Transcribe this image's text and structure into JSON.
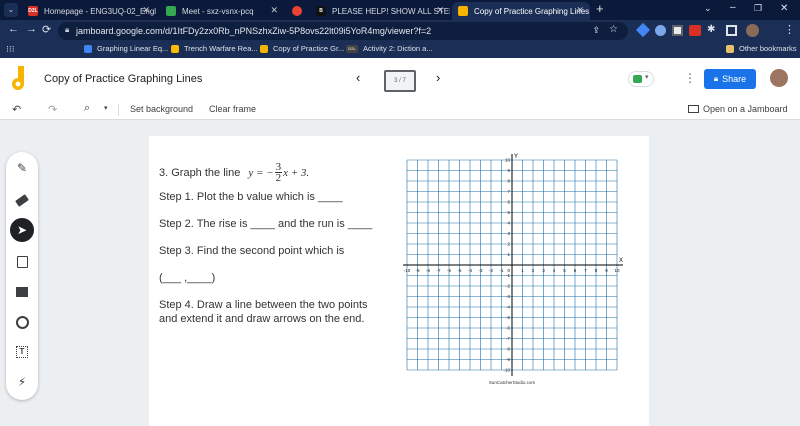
{
  "browser": {
    "tabs": [
      {
        "title": "Homepage - ENG3UQ-02_English",
        "favicon_text": "D2L",
        "favicon_color": "#d93025",
        "active": false
      },
      {
        "title": "Meet - sxz-vsnx-pcq",
        "favicon_text": "",
        "favicon_color": "#34a853",
        "active": false
      },
      {
        "title": "",
        "favicon_text": "",
        "favicon_color": "#ea4335",
        "active": false
      },
      {
        "title": "PLEASE HELP! SHOW ALL STEPS",
        "favicon_text": "B",
        "favicon_color": "#111111",
        "active": false
      },
      {
        "title": "Copy of Practice Graphing Lines",
        "favicon_text": "",
        "favicon_color": "#f4b400",
        "active": true
      }
    ],
    "new_tab": "+",
    "url": "jamboard.google.com/d/1ItFDy2zx0Rb_nPNSzhxZiw-5P8ovs22lt09i5YoR4mg/viewer?f=2",
    "bookmarks": [
      {
        "label": "Graphing Linear Eq...",
        "color": "#4285f4"
      },
      {
        "label": "Trench Warfare Rea...",
        "color": "#fbbc04"
      },
      {
        "label": "Copy of Practice Gr...",
        "color": "#f4b400"
      },
      {
        "label": "Activity 2: Diction a...",
        "color": "#444444",
        "text": "D2L"
      }
    ],
    "other_bookmarks": "Other bookmarks"
  },
  "jamboard": {
    "title": "Copy of Practice Graphing Lines",
    "frame_counter": "3 / 7",
    "share_label": "Share",
    "toolbar": {
      "set_background": "Set background",
      "clear_frame": "Clear frame",
      "open_jamboard": "Open on a Jamboard"
    }
  },
  "frame_content": {
    "question": "3. Graph the line",
    "equation": {
      "lhs": "y = −",
      "numerator": "3",
      "denominator": "2",
      "rhs": "x + 3."
    },
    "step1": "Step 1. Plot the b value which is ____",
    "step2": "Step 2. The rise is ____ and the run is ____",
    "step3": "Step 3. Find the second point which is",
    "point_blank": "(___ ,____)",
    "step4_line1": "Step 4. Draw a line between the two points",
    "step4_line2": "and extend it and draw arrows on the end.",
    "grid": {
      "x_axis_label": "X",
      "y_axis_label": "Y",
      "min": -10,
      "max": 10,
      "credit": "SunCatcherStudio.com"
    }
  }
}
